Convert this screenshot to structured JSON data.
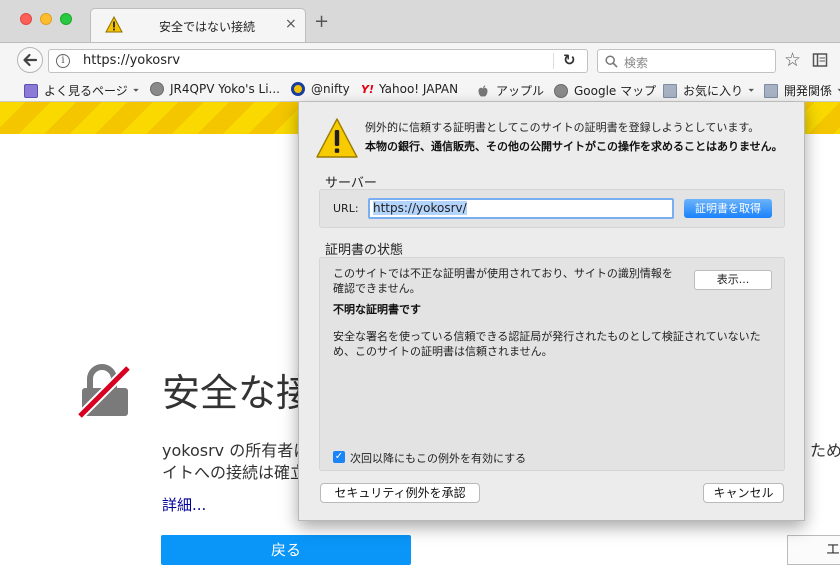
{
  "tab": {
    "title": "安全ではない接続",
    "close": "×",
    "new_tab": "+"
  },
  "nav": {
    "url": "https://yokosrv",
    "search_placeholder": "検索",
    "info": "i"
  },
  "bookmarks": [
    {
      "label": "よく見るページ",
      "icon": "smart-folder-icon",
      "caret": "⏷"
    },
    {
      "label": "JR4QPV Yoko's Li...",
      "icon": "globe-icon"
    },
    {
      "label": "@nifty",
      "icon": "nifty-logo-icon"
    },
    {
      "label": "Yahoo! JAPAN",
      "icon": "yahoo-logo-icon",
      "logo": "Y!"
    },
    {
      "label": "アップル",
      "icon": "apple-icon"
    },
    {
      "label": "Google マップ",
      "icon": "globe-icon"
    },
    {
      "label": "お気に入り",
      "icon": "folder-icon",
      "caret": "⏷"
    },
    {
      "label": "開発関係",
      "icon": "folder-icon",
      "caret": "⏷"
    }
  ],
  "page": {
    "title": "安全な接",
    "body_line1": "yokosrv の所有者に",
    "body_line2": "イトへの接続は確立",
    "body_right": "ため、",
    "details_link": "詳細...",
    "back_button": "戻る",
    "right_button": "エ"
  },
  "dialog": {
    "message1": "例外的に信頼する証明書としてこのサイトの証明書を登録しようとしています。",
    "message2": "本物の銀行、通信販売、その他の公開サイトがこの操作を求めることはありません。",
    "server_label": "サーバー",
    "url_label": "URL:",
    "url_value": "https://yokosrv/",
    "get_cert_button": "証明書を取得",
    "status_label": "証明書の状態",
    "status_desc1": "このサイトでは不正な証明書が使用されており、サイトの識別情報を",
    "status_desc2": "確認できません。",
    "view_button": "表示...",
    "unknown_cert": "不明な証明書です",
    "status_detail1": "安全な署名を使っている信頼できる認証局が発行されたものとして検証されていないた",
    "status_detail2": "め、このサイトの証明書は信頼されません。",
    "checkbox_label": "次回以降にもこの例外を有効にする",
    "checkbox_checked": true,
    "confirm_button": "セキュリティ例外を承認",
    "cancel_button": "キャンセル"
  },
  "colors": {
    "accent": "#0996f8",
    "warning_stripe": "#f9d900",
    "dialog_bg": "#ececec"
  }
}
